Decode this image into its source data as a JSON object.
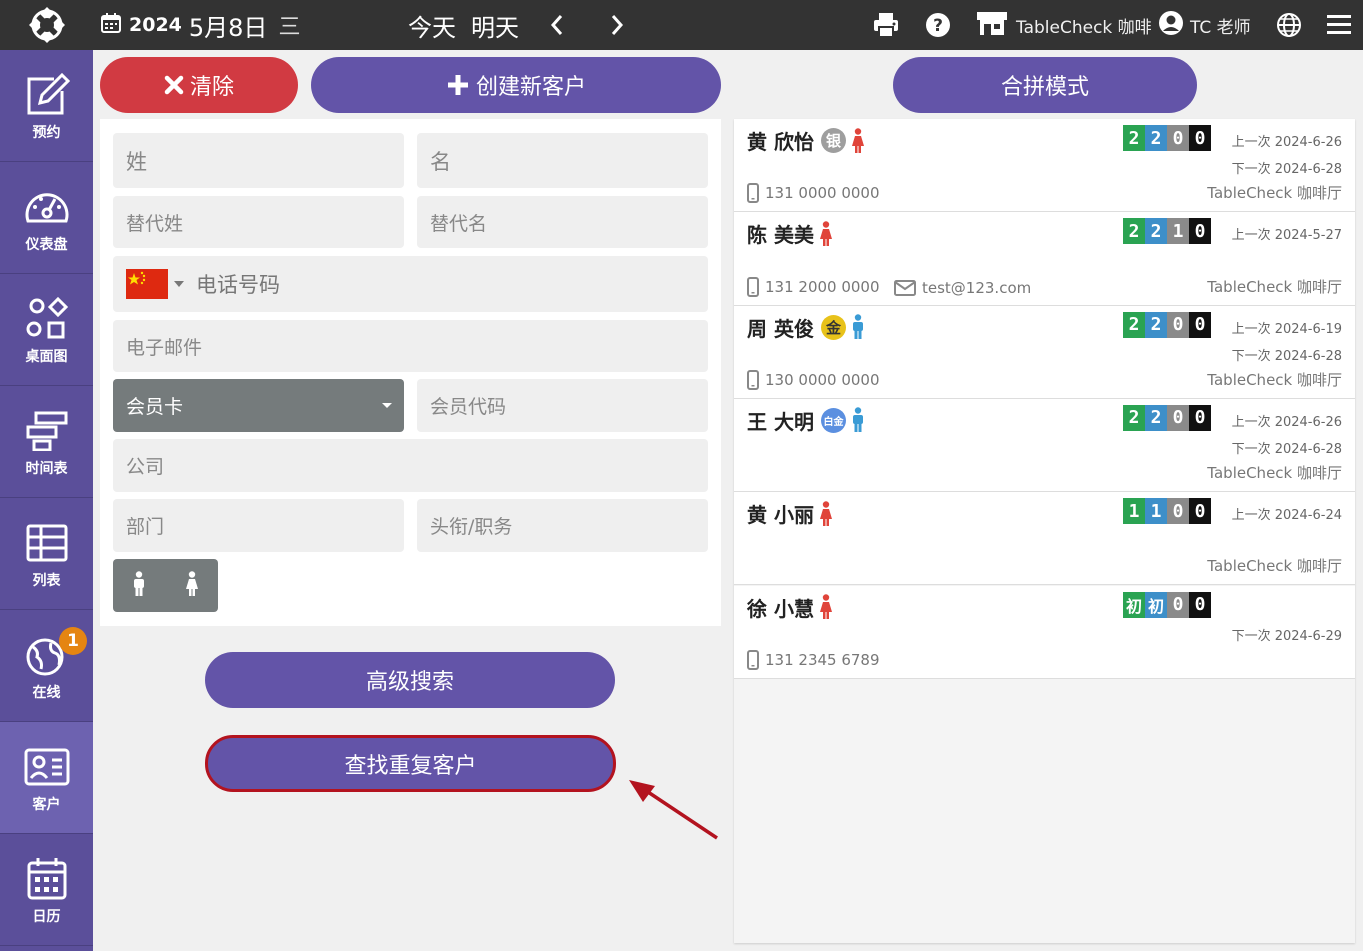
{
  "header": {
    "year": "2024",
    "month_day": "5月8日",
    "weekday": "三",
    "today": "今天",
    "tomorrow": "明天",
    "store": "TableCheck 咖啡",
    "user": "TC 老师",
    "icons": [
      "calendar-icon",
      "chevron-left-icon",
      "chevron-right-icon",
      "print-icon",
      "help-icon",
      "store-icon",
      "user-icon",
      "globe-icon",
      "menu-icon"
    ]
  },
  "sidebar": {
    "items": [
      {
        "label": "预约",
        "icon": "edit-icon"
      },
      {
        "label": "仪表盘",
        "icon": "dashboard-icon"
      },
      {
        "label": "桌面图",
        "icon": "floorplan-icon"
      },
      {
        "label": "时间表",
        "icon": "timeline-icon"
      },
      {
        "label": "列表",
        "icon": "list-icon"
      },
      {
        "label": "在线",
        "icon": "online-icon",
        "badge": "1"
      },
      {
        "label": "客户",
        "icon": "customer-icon",
        "active": true
      },
      {
        "label": "日历",
        "icon": "calendar-icon"
      }
    ]
  },
  "buttons": {
    "clear": "清除",
    "create": "创建新客户",
    "merge": "合拼模式",
    "advanced": "高级搜索",
    "duplicates": "查找重复客户"
  },
  "form": {
    "last_name": "姓",
    "first_name": "名",
    "alt_last_name": "替代姓",
    "alt_first_name": "替代名",
    "phone": "电话号码",
    "email": "电子邮件",
    "member_card": "会员卡",
    "member_code": "会员代码",
    "company": "公司",
    "department": "部门",
    "title": "头衔/职务"
  },
  "colors": {
    "sidebar": "#5b4f9a",
    "primary": "#6354a8",
    "danger": "#d13a42",
    "count_green": "#2aa352",
    "count_blue": "#3d8fc9",
    "count_gray": "#8a8a8a",
    "count_black": "#111111",
    "female": "#e0443a",
    "male": "#3a9bd5"
  },
  "customers": [
    {
      "name": "黄 欣怡",
      "tier": "银",
      "tier_color": "#9e9e9e",
      "gender": "female",
      "counts": [
        "2",
        "2",
        "0",
        "0"
      ],
      "last_visit": "上一次 2024-6-26",
      "next_visit": "下一次 2024-6-28",
      "phone": "131 0000 0000",
      "email": "",
      "venue": "TableCheck 咖啡厅"
    },
    {
      "name": "陈 美美",
      "tier": "",
      "tier_color": "",
      "gender": "female",
      "counts": [
        "2",
        "2",
        "1",
        "0"
      ],
      "last_visit": "上一次 2024-5-27",
      "next_visit": "",
      "phone": "131 2000 0000",
      "email": "test@123.com",
      "venue": "TableCheck 咖啡厅"
    },
    {
      "name": "周 英俊",
      "tier": "金",
      "tier_color": "#e8c21a",
      "gender": "male",
      "counts": [
        "2",
        "2",
        "0",
        "0"
      ],
      "last_visit": "上一次 2024-6-19",
      "next_visit": "下一次 2024-6-28",
      "phone": "130 0000 0000",
      "email": "",
      "venue": "TableCheck 咖啡厅"
    },
    {
      "name": "王 大明",
      "tier": "白金",
      "tier_color": "#5b8fe0",
      "gender": "male",
      "counts": [
        "2",
        "2",
        "0",
        "0"
      ],
      "last_visit": "上一次 2024-6-26",
      "next_visit": "下一次 2024-6-28",
      "phone": "",
      "email": "",
      "venue": "TableCheck 咖啡厅"
    },
    {
      "name": "黄 小丽",
      "tier": "",
      "tier_color": "",
      "gender": "female",
      "counts": [
        "1",
        "1",
        "0",
        "0"
      ],
      "last_visit": "上一次 2024-6-24",
      "next_visit": "",
      "phone": "",
      "email": "",
      "venue": "TableCheck 咖啡厅"
    },
    {
      "name": "徐 小慧",
      "tier": "",
      "tier_color": "",
      "gender": "female",
      "counts": [
        "初",
        "初",
        "0",
        "0"
      ],
      "last_visit": "",
      "next_visit": "下一次 2024-6-29",
      "phone": "131 2345 6789",
      "email": "",
      "venue": ""
    }
  ]
}
